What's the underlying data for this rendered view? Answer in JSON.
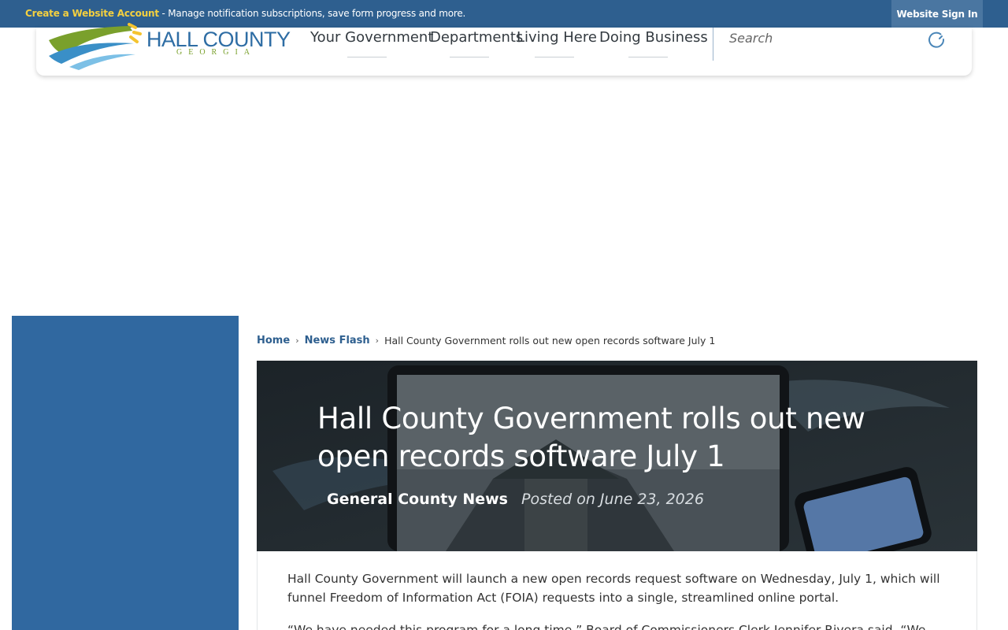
{
  "topbar": {
    "create_label": "Create a Website Account",
    "message": " - Manage notification subscriptions, save form progress and more.",
    "signin_label": "Website Sign In"
  },
  "header": {
    "logo_title": "HALL COUNTY",
    "logo_subtitle": "GEORGIA",
    "nav": [
      {
        "label": "Your Government"
      },
      {
        "label": "Departments"
      },
      {
        "label": "Living Here"
      },
      {
        "label": "Doing Business"
      }
    ],
    "search": {
      "placeholder": "Search"
    }
  },
  "breadcrumb": {
    "home": "Home",
    "section": "News Flash",
    "current": "Hall County Government rolls out new open records software July 1"
  },
  "article": {
    "title": "Hall County Government rolls out new open records software July 1",
    "category": "General County News",
    "posted": "Posted on June 23, 2026",
    "paragraphs": [
      "Hall County Government will launch a new open records request software on Wednesday, July 1, which will funnel Freedom of Information Act (FOIA) requests into a single, streamlined online portal.",
      "“We have needed this program for a long time,” Board of Commissioners Clerk Jennifer Rivera said. “We"
    ]
  },
  "colors": {
    "brand_blue": "#2e5f8f",
    "sidebar_blue": "#3068a0",
    "accent_yellow": "#f4d03f",
    "logo_green": "#7aa02c"
  }
}
